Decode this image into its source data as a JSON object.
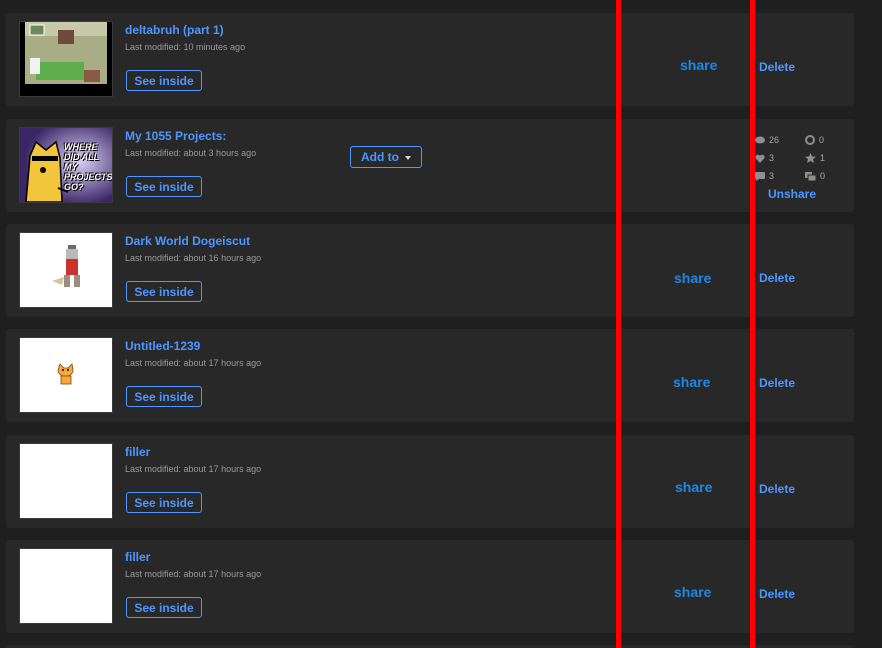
{
  "projects": [
    {
      "title": "deltabruh (part 1)",
      "modified": "Last modified: 10 minutes ago",
      "see_inside": "See inside",
      "share": "share",
      "delete": "Delete"
    },
    {
      "title": "My 1055 Projects:",
      "modified": "Last modified: about 3 hours ago",
      "see_inside": "See inside",
      "add_to": "Add to",
      "stats": {
        "views": "26",
        "remixes": "0",
        "loves": "3",
        "favorites": "1",
        "comments": "3",
        "studios": "0"
      },
      "thumb_text": "WHERE DID ALL MY PROJECTS GO?",
      "unshare": "Unshare"
    },
    {
      "title": "Dark World Dogeiscut",
      "modified": "Last modified: about 16 hours ago",
      "see_inside": "See inside",
      "share": "share",
      "delete": "Delete"
    },
    {
      "title": "Untitled-1239",
      "modified": "Last modified: about 17 hours ago",
      "see_inside": "See inside",
      "share": "share",
      "delete": "Delete"
    },
    {
      "title": "filler",
      "modified": "Last modified: about 17 hours ago",
      "see_inside": "See inside",
      "share": "share",
      "delete": "Delete"
    },
    {
      "title": "filler",
      "modified": "Last modified: about 17 hours ago",
      "see_inside": "See inside",
      "share": "share",
      "delete": "Delete"
    }
  ],
  "colors": {
    "accent": "#4d97ff",
    "share": "#1e88e5",
    "card": "#282828",
    "background": "#1f1f1f",
    "annotation_line": "#ff0000"
  },
  "icons": {
    "views": "eye-icon",
    "remixes": "remix-icon",
    "loves": "heart-icon",
    "favorites": "star-icon",
    "comments": "comment-icon",
    "studios": "studio-icon"
  }
}
